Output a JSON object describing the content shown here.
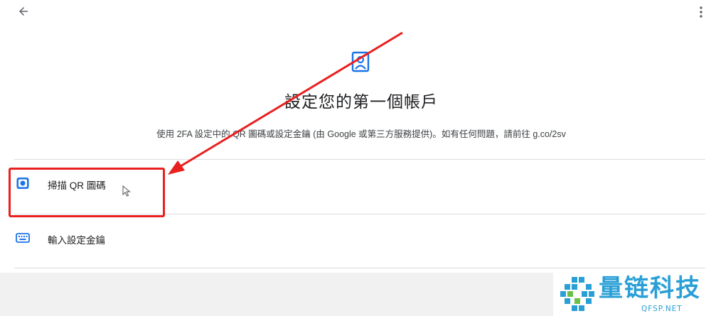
{
  "header": {
    "back_icon": "arrow-back-icon",
    "more_icon": "more-vertical-icon"
  },
  "main": {
    "header_icon": "account-box-icon",
    "title": "設定您的第一個帳戶",
    "description": "使用 2FA 設定中的 QR 圖碼或設定金鑰 (由 Google 或第三方服務提供)。如有任何問題，請前往 g.co/2sv",
    "options": [
      {
        "icon": "camera-icon",
        "label": "掃描 QR 圖碼"
      },
      {
        "icon": "keyboard-icon",
        "label": "輸入設定金鑰"
      }
    ]
  },
  "annotation": {
    "color": "#e8201f"
  },
  "colors": {
    "accent": "#1a73e8",
    "annotation": "#e8201f",
    "watermark": "#2a9fd6"
  },
  "watermark": {
    "name": "量链科技",
    "url": "QFSP.NET"
  }
}
